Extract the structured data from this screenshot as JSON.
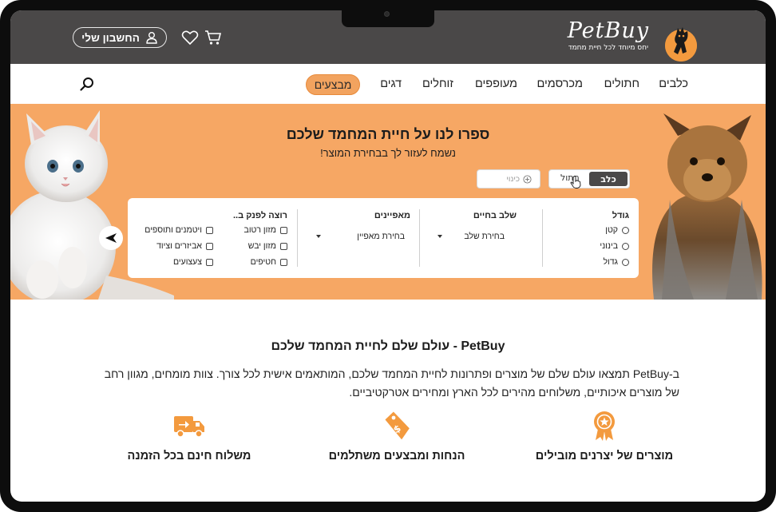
{
  "brand": {
    "logo_text": "PetBuy",
    "tagline": "יחס מיוחד לכל חיית מחמד"
  },
  "header": {
    "account_label": "החשבון שלי",
    "icons": [
      "user-icon",
      "heart-icon",
      "cart-icon",
      "search-icon"
    ]
  },
  "nav": {
    "items": [
      "כלבים",
      "חתולים",
      "מכרסמים",
      "מעופפים",
      "זוחלים",
      "דגים"
    ],
    "deals_label": "מבצעים"
  },
  "hero": {
    "title": "ספרו לנו על חיית המחמד שלכם",
    "subtitle": "נשמח לעזור לך בבחירת המוצר!",
    "toggle": {
      "dog": "כלב",
      "cat": "חתול",
      "selected": "כלב"
    },
    "nickname_placeholder": "כינוי",
    "filters": {
      "size": {
        "title": "גודל",
        "options": [
          "קטן",
          "בינוני",
          "גדול"
        ]
      },
      "life_stage": {
        "title": "שלב בחיים",
        "placeholder": "בחירת שלב"
      },
      "traits": {
        "title": "מאפיינים",
        "placeholder": "בחירת מאפיין"
      },
      "pamper": {
        "title": "רוצה לפנק ב..",
        "options_col1": [
          "מזון רטוב",
          "מזון יבש",
          "חטיפים"
        ],
        "options_col2": [
          "ויטמנים ותוספים",
          "אביזרים וציוד",
          "צעצועים"
        ]
      }
    }
  },
  "intro": {
    "title": "PetBuy - עולם שלם לחיית המחמד שלכם",
    "text": "ב-PetBuy תמצאו עולם שלם של מוצרים ופתרונות לחיית המחמד שלכם, המותאמים אישית לכל צורך. צוות מומחים, מגוון רחב של מוצרים איכותיים, משלוחים מהירים לכל הארץ ומחירים אטרקטיביים."
  },
  "features": [
    {
      "icon": "award-ribbon-icon",
      "label": "מוצרים של יצרנים מובילים"
    },
    {
      "icon": "discount-tag-icon",
      "label": "הנחות ומבצעים משתלמים"
    },
    {
      "icon": "delivery-truck-icon",
      "label": "משלוח חינם בכל הזמנה"
    }
  ],
  "colors": {
    "accent": "#f6a764",
    "header_bg": "#4a4848",
    "icon_orange": "#f39a3e"
  }
}
